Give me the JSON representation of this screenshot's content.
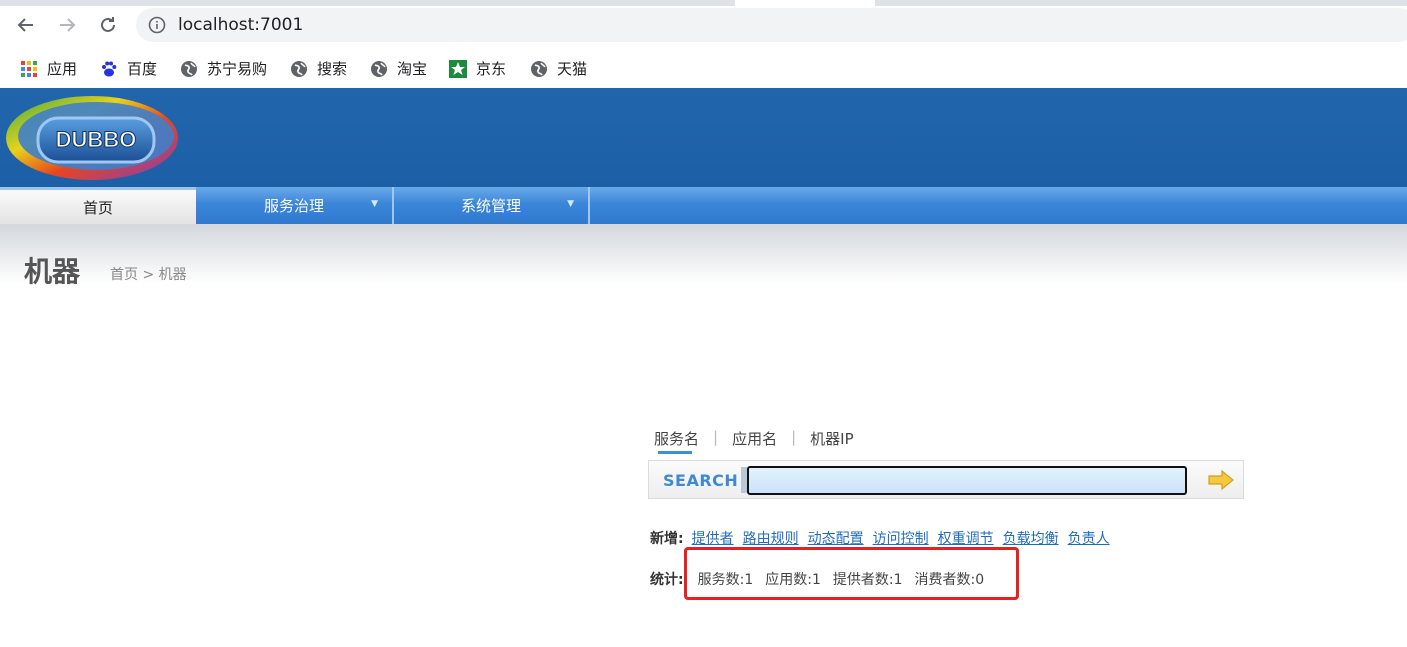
{
  "browser": {
    "url": "localhost:7001",
    "bookmarks": [
      {
        "label": "应用",
        "icon": "apps-grid-icon"
      },
      {
        "label": "百度",
        "icon": "baidu-paw-icon"
      },
      {
        "label": "苏宁易购",
        "icon": "globe-icon"
      },
      {
        "label": "搜索",
        "icon": "globe-icon"
      },
      {
        "label": "淘宝",
        "icon": "globe-icon"
      },
      {
        "label": "京东",
        "icon": "jd-icon"
      },
      {
        "label": "天猫",
        "icon": "globe-icon"
      }
    ]
  },
  "header": {
    "logo_text": "DUBBO"
  },
  "nav": {
    "tabs": [
      {
        "label": "首页",
        "active": true
      },
      {
        "label": "服务治理",
        "dropdown": true
      },
      {
        "label": "系统管理",
        "dropdown": true
      }
    ],
    "dropdown_arrow": "▼"
  },
  "page": {
    "title": "机器",
    "breadcrumb": "首页 > 机器"
  },
  "search": {
    "tabs": [
      "服务名",
      "应用名",
      "机器IP"
    ],
    "active_tab": 0,
    "divider": "|",
    "label": "SEARCH",
    "input_value": ""
  },
  "add": {
    "label": "新增:",
    "links": [
      "提供者",
      "路由规则",
      "动态配置",
      "访问控制",
      "权重调节",
      "负载均衡",
      "负责人"
    ]
  },
  "stats": {
    "label": "统计:",
    "items": [
      "服务数:1",
      "应用数:1",
      "提供者数:1",
      "消费者数:0"
    ]
  },
  "colors": {
    "header_blue": "#2166ad",
    "nav_blue": "#3b86d8",
    "link_blue": "#1f6cc0",
    "highlight_red": "#e82020"
  }
}
